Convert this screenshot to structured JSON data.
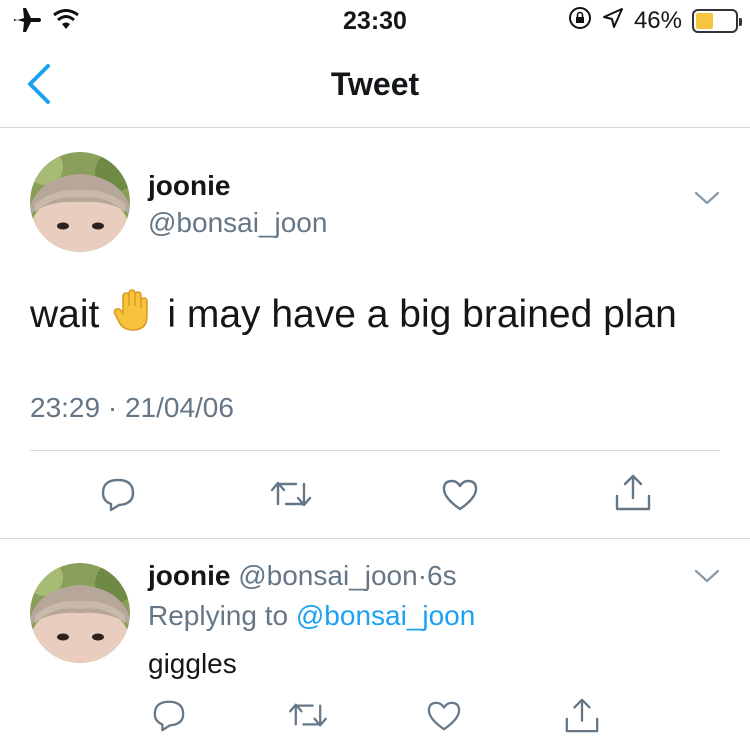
{
  "status_bar": {
    "time": "23:30",
    "battery_percent": "46%",
    "battery_level": 0.46,
    "icons": [
      "airplane-mode-icon",
      "wifi-icon",
      "orientation-lock-icon",
      "location-icon",
      "battery-icon"
    ]
  },
  "nav": {
    "title": "Tweet",
    "back_icon": "chevron-left-icon"
  },
  "main_tweet": {
    "display_name": "joonie",
    "handle": "@bonsai_joon",
    "text_before": "wait",
    "emoji": "raised-hand",
    "text_after": "i may have a big brained plan",
    "timestamp": "23:29 · 21/04/06",
    "actions": [
      "reply-icon",
      "retweet-icon",
      "like-icon",
      "share-icon"
    ]
  },
  "reply_tweet": {
    "display_name": "joonie",
    "handle": "@bonsai_joon",
    "separator": "·",
    "age": "6s",
    "replying_prefix": "Replying to",
    "replying_to": "@bonsai_joon",
    "text": "giggles",
    "actions": [
      "reply-icon",
      "retweet-icon",
      "like-icon",
      "share-icon"
    ]
  },
  "colors": {
    "accent": "#1da1f2",
    "muted_text": "#657786",
    "icon_gray": "#657786",
    "battery_fill": "#f5c542"
  }
}
